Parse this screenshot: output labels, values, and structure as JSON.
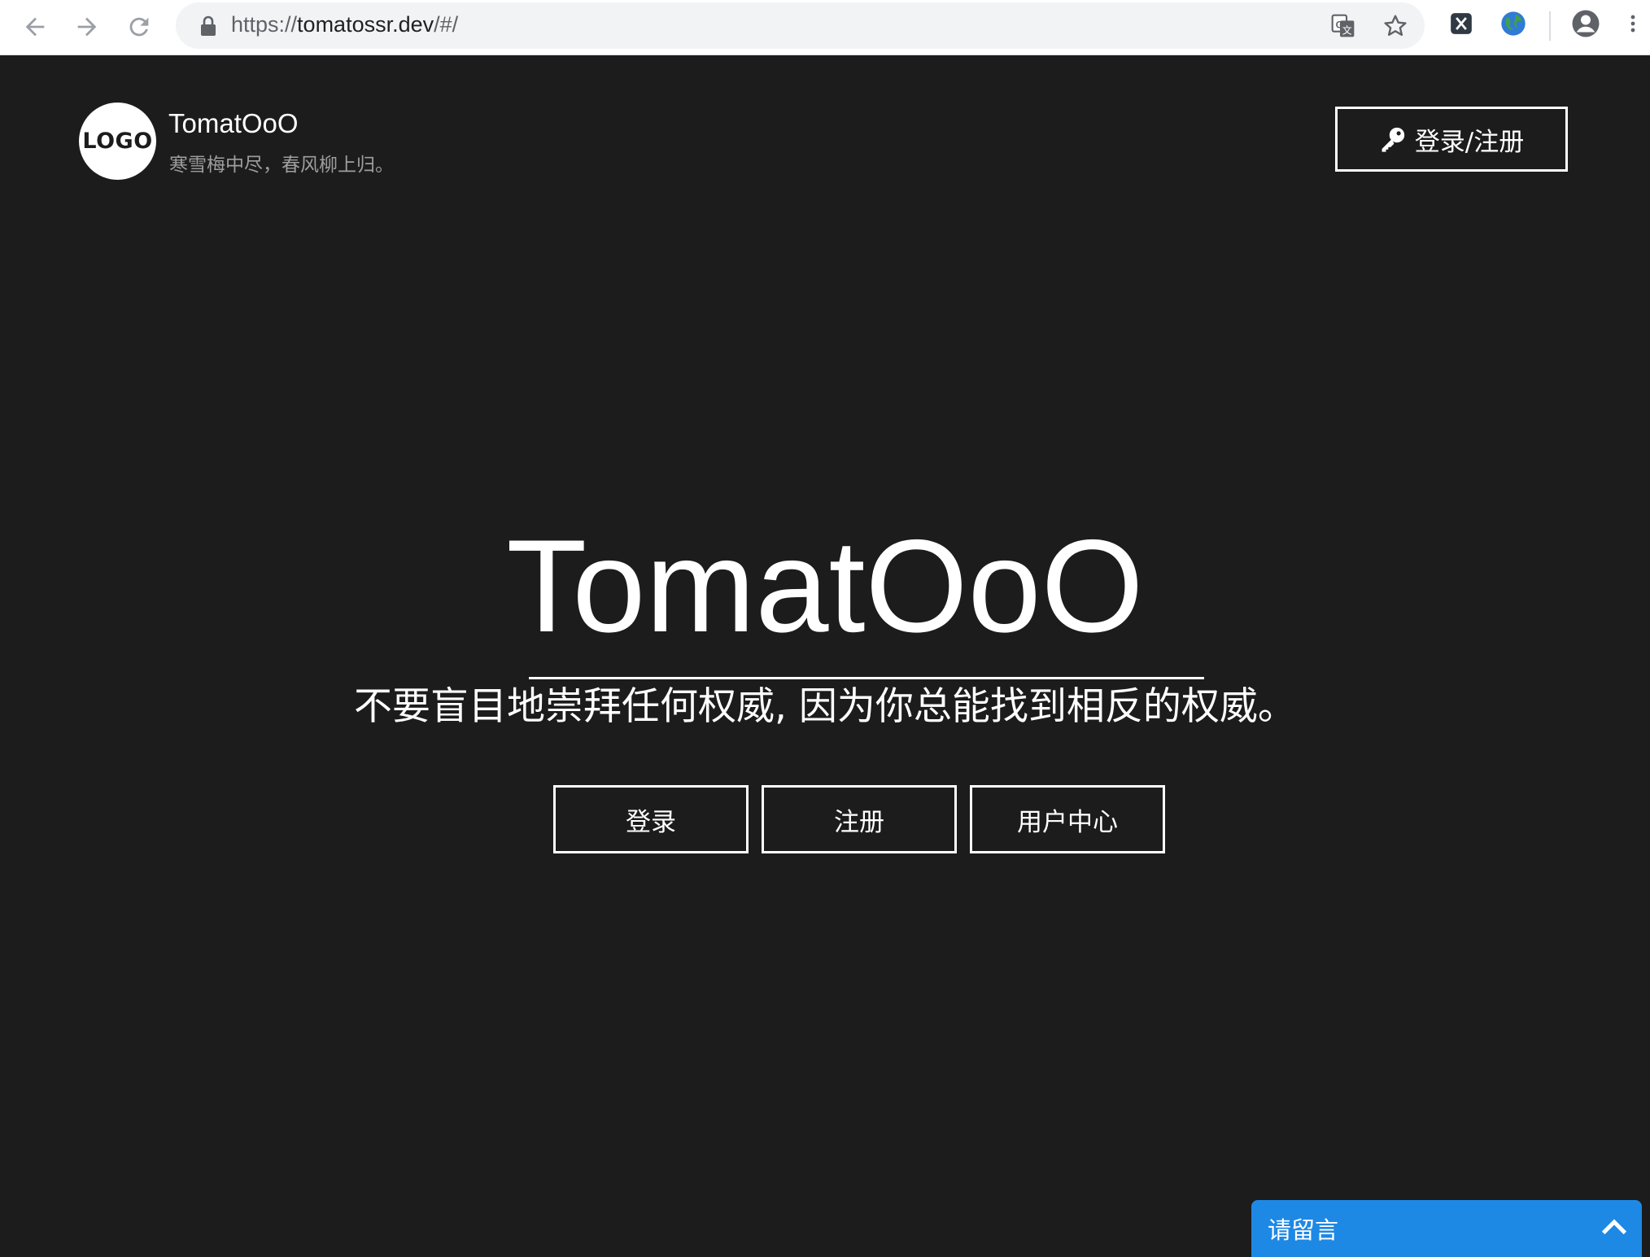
{
  "browser": {
    "url_scheme": "https://",
    "url_host": "tomatossr.dev",
    "url_path": "/#/"
  },
  "header": {
    "logo_text": "LOGO",
    "site_name": "TomatOoO",
    "tagline": "寒雪梅中尽，春风柳上归。",
    "login_register_label": "登录/注册"
  },
  "hero": {
    "title": "TomatOoO",
    "quote": "不要盲目地崇拜任何权威, 因为你总能找到相反的权威。",
    "buttons": [
      "登录",
      "注册",
      "用户中心"
    ]
  },
  "message_widget": {
    "label": "请留言"
  }
}
